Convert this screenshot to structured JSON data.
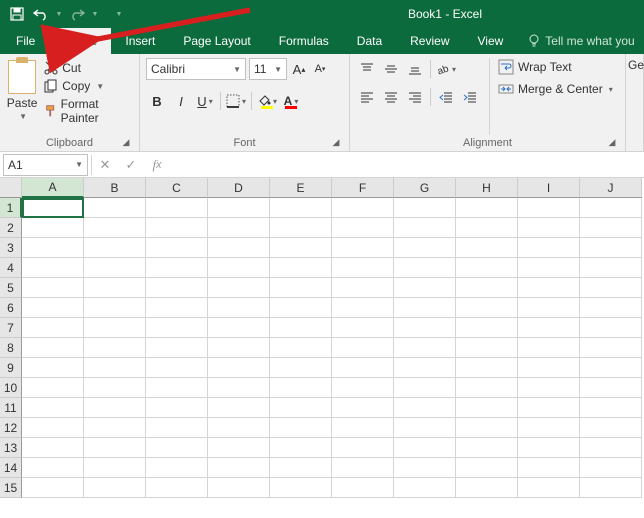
{
  "titlebar": {
    "title": "Book1 - Excel"
  },
  "tabs": {
    "file": "File",
    "home": "Home",
    "insert": "Insert",
    "pagelayout": "Page Layout",
    "formulas": "Formulas",
    "data": "Data",
    "review": "Review",
    "view": "View",
    "tell": "Tell me what you"
  },
  "clipboard": {
    "paste": "Paste",
    "cut": "Cut",
    "copy": "Copy",
    "format_painter": "Format Painter",
    "label": "Clipboard"
  },
  "font": {
    "name": "Calibri",
    "size": "11",
    "label": "Font"
  },
  "alignment": {
    "wrap": "Wrap Text",
    "merge": "Merge & Center",
    "label": "Alignment"
  },
  "tellme_partial": "Ge",
  "formula_bar": {
    "namebox": "A1"
  },
  "grid": {
    "columns": [
      "A",
      "B",
      "C",
      "D",
      "E",
      "F",
      "G",
      "H",
      "I",
      "J"
    ],
    "rows": [
      "1",
      "2",
      "3",
      "4",
      "5",
      "6",
      "7",
      "8",
      "9",
      "10",
      "11",
      "12",
      "13",
      "14",
      "15"
    ]
  }
}
